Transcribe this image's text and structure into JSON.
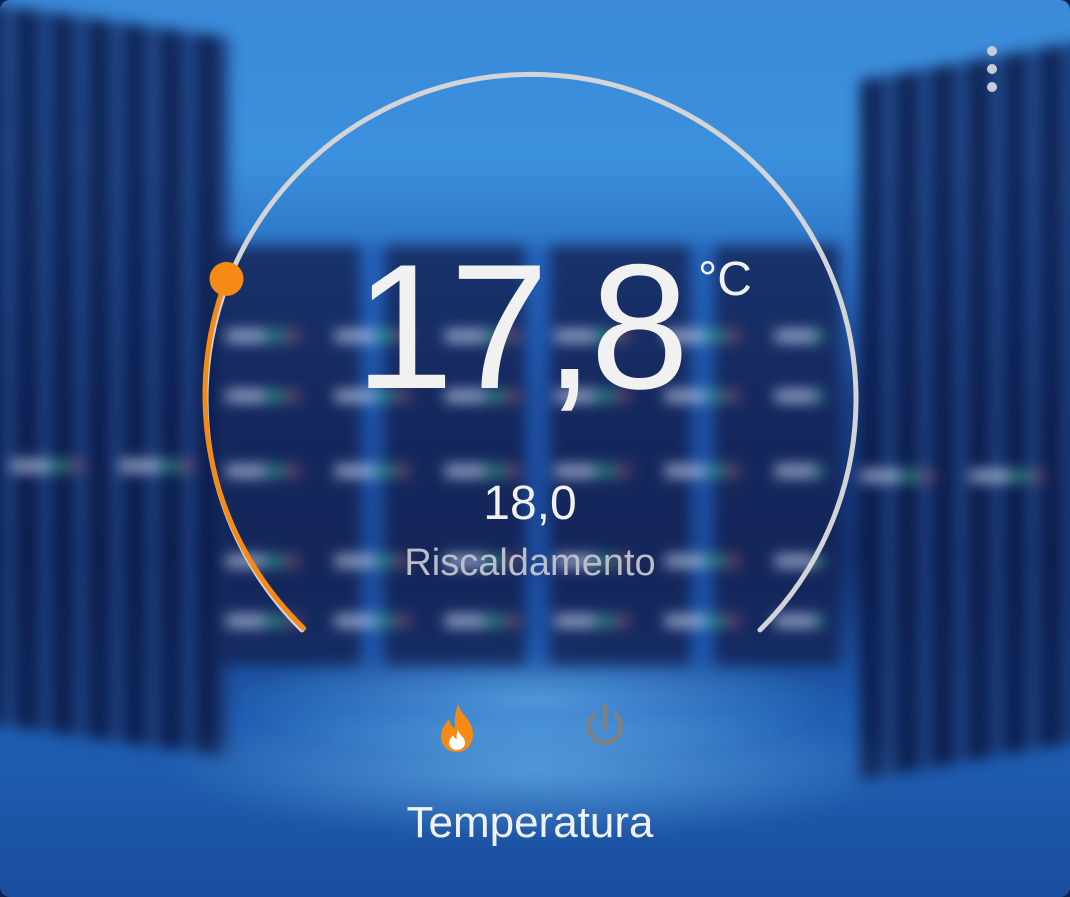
{
  "thermostat": {
    "current_temperature": "17,8",
    "unit": "°C",
    "target_temperature": "18,0",
    "hvac_action": "Riscaldamento",
    "name": "Temperatura",
    "target_fraction_of_range": 0.25
  },
  "controls": {
    "modes": [
      {
        "icon": "flame-icon",
        "active": true
      },
      {
        "icon": "power-icon",
        "active": false
      }
    ],
    "menu_icon": "dots-vertical-icon"
  },
  "colors": {
    "accent_heat": "#f68a16",
    "dial_track": "#d3d4d6",
    "inactive_icon": "#7d8087",
    "text": "#f1f1f1",
    "secondary_text": "#b9bec8"
  }
}
